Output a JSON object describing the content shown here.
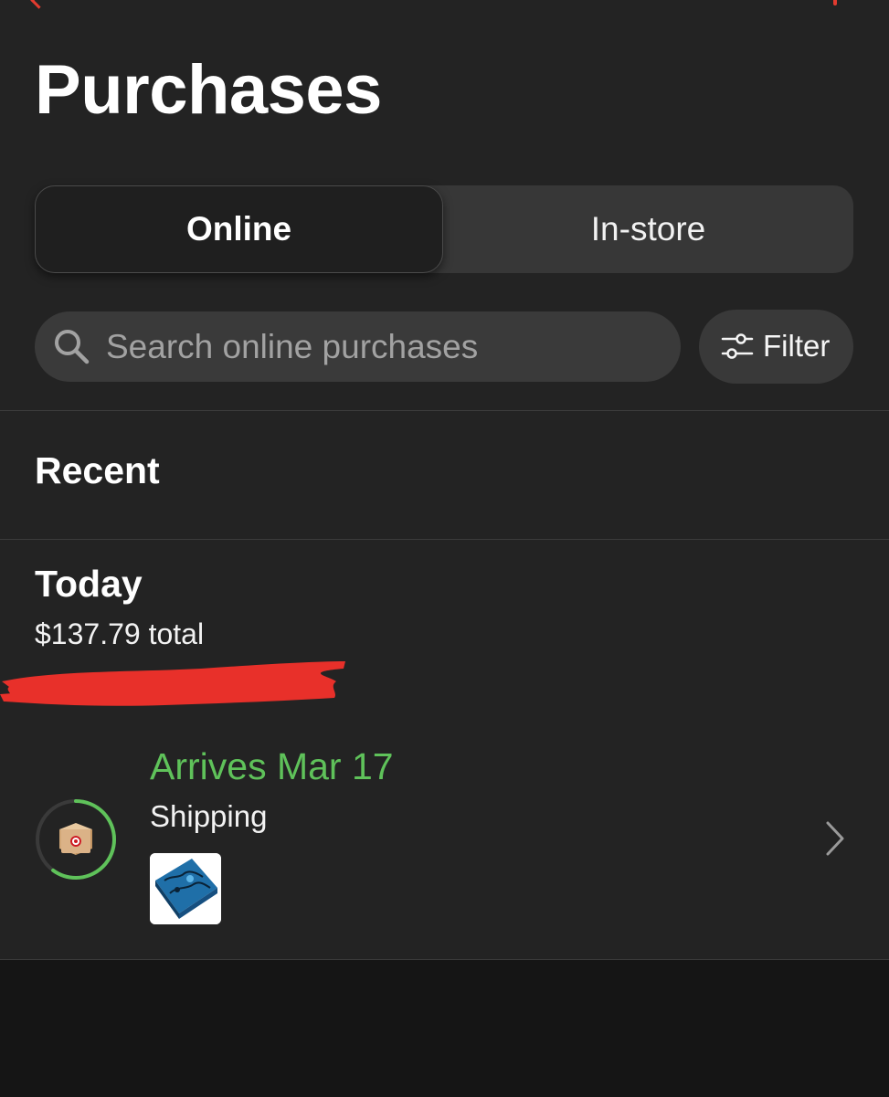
{
  "header": {
    "title": "Purchases"
  },
  "tabs": [
    {
      "label": "Online",
      "selected": true
    },
    {
      "label": "In-store",
      "selected": false
    }
  ],
  "search": {
    "placeholder": "Search online purchases",
    "value": "",
    "icon": "search-icon"
  },
  "filter": {
    "label": "Filter",
    "icon": "sliders-icon"
  },
  "recent": {
    "heading": "Recent"
  },
  "group": {
    "date_label": "Today",
    "total": "$137.79 total"
  },
  "order": {
    "arrival": "Arrives Mar 17",
    "status": "Shipping",
    "progress": 0.6,
    "status_icon": "package-box-icon",
    "item_thumbnail": "product-image"
  },
  "colors": {
    "accent_green": "#5fc25a",
    "brand_red": "#e23b2f",
    "background": "#232323"
  }
}
